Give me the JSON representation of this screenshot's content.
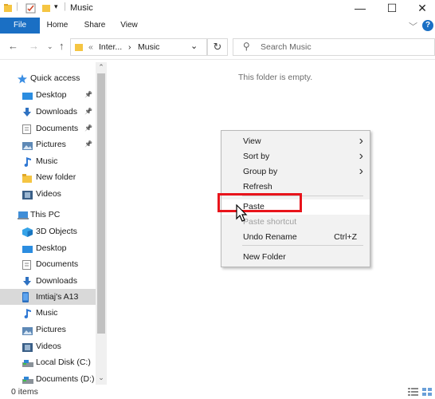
{
  "window": {
    "title": "Music",
    "controls": {
      "minimize": "—",
      "maximize": "☐",
      "close": "✕"
    }
  },
  "ribbon": {
    "tabs": [
      "File",
      "Home",
      "Share",
      "View"
    ]
  },
  "address": {
    "overflow": "«",
    "crumbs": [
      "Inter...",
      "Music"
    ],
    "separator": "›"
  },
  "search": {
    "placeholder": "Search Music"
  },
  "nav_pane": {
    "items": [
      {
        "label": "Quick access",
        "icon": "star-icon",
        "pinned": false,
        "level": 0
      },
      {
        "label": "Desktop",
        "icon": "desktop-icon",
        "pinned": true,
        "level": 1
      },
      {
        "label": "Downloads",
        "icon": "download-icon",
        "pinned": true,
        "level": 1
      },
      {
        "label": "Documents",
        "icon": "document-icon",
        "pinned": true,
        "level": 1
      },
      {
        "label": "Pictures",
        "icon": "pictures-icon",
        "pinned": true,
        "level": 1
      },
      {
        "label": "Music",
        "icon": "music-icon",
        "pinned": false,
        "level": 1
      },
      {
        "label": "New folder",
        "icon": "folder-icon",
        "pinned": false,
        "level": 1
      },
      {
        "label": "Videos",
        "icon": "videos-icon",
        "pinned": false,
        "level": 1
      },
      {
        "label": "This PC",
        "icon": "computer-icon",
        "pinned": false,
        "level": 0
      },
      {
        "label": "3D Objects",
        "icon": "cube-icon",
        "pinned": false,
        "level": 1
      },
      {
        "label": "Desktop",
        "icon": "desktop-icon",
        "pinned": false,
        "level": 1
      },
      {
        "label": "Documents",
        "icon": "document-icon",
        "pinned": false,
        "level": 1
      },
      {
        "label": "Downloads",
        "icon": "download-icon",
        "pinned": false,
        "level": 1
      },
      {
        "label": "Imtiaj's A13",
        "icon": "phone-icon",
        "pinned": false,
        "level": 1,
        "selected": true
      },
      {
        "label": "Music",
        "icon": "music-icon",
        "pinned": false,
        "level": 1
      },
      {
        "label": "Pictures",
        "icon": "pictures-icon",
        "pinned": false,
        "level": 1
      },
      {
        "label": "Videos",
        "icon": "videos-icon",
        "pinned": false,
        "level": 1
      },
      {
        "label": "Local Disk (C:)",
        "icon": "disk-icon",
        "pinned": false,
        "level": 1
      },
      {
        "label": "Documents (D:)",
        "icon": "disk-icon",
        "pinned": false,
        "level": 1
      }
    ]
  },
  "content": {
    "empty_message": "This folder is empty."
  },
  "context_menu": {
    "items": [
      {
        "label": "View",
        "submenu": true
      },
      {
        "label": "Sort by",
        "submenu": true
      },
      {
        "label": "Group by",
        "submenu": true
      },
      {
        "label": "Refresh"
      },
      {
        "label": "Paste",
        "highlighted": true
      },
      {
        "label": "Paste shortcut",
        "disabled": true
      },
      {
        "label": "Undo Rename",
        "shortcut": "Ctrl+Z"
      },
      {
        "label": "New Folder"
      }
    ]
  },
  "status": {
    "items_count": "0 items"
  },
  "colors": {
    "accent": "#1a6fc4",
    "highlight_border": "#e8141b",
    "selection": "#d9d9d9"
  }
}
